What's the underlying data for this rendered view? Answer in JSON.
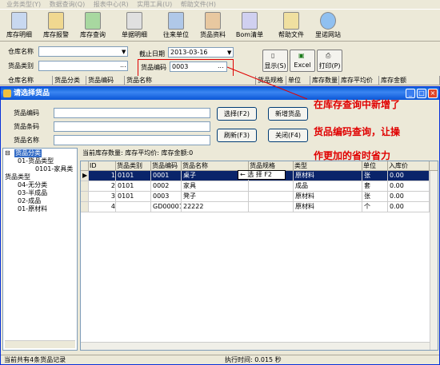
{
  "menu": [
    "业务类型(Y)",
    "数据查询(Q)",
    "报表中心(R)",
    "实用工具(U)",
    "帮助文件(H)"
  ],
  "toolbar": [
    "库存明细",
    "库存报警",
    "库存查询",
    "单据明细",
    "往来单位",
    "货品资料",
    "Bom清单",
    "帮助文件",
    "里诺网站"
  ],
  "filters": {
    "warehouse_label": "仓库名称",
    "category_label": "货品类别",
    "date_label": "截止日期",
    "date_value": "2013-03-16",
    "code_label": "货品编码",
    "code_value": "0003",
    "ellipsis": "...",
    "show_btn": "显示(S)",
    "excel_btn": "Excel",
    "print_btn": "打印(P)"
  },
  "main_columns": [
    "仓库名称",
    "货品分类",
    "货品编码",
    "货品名称",
    "货品规格",
    "单位",
    "库存数量",
    "库存平均价",
    "库存金额"
  ],
  "dialog": {
    "title": "请选择货品",
    "code_label": "货品编码",
    "barcode_label": "货品条码",
    "name_label": "货品名称",
    "select_btn": "选择(F2)",
    "add_btn": "新增货品",
    "refresh_btn": "刷新(F3)",
    "close_btn": "关闭(F4)",
    "summary": "当前库存数量:  库存平均价:  库存金额:0",
    "status_left": "当前共有4条货品记录",
    "status_right": "执行时间: 0.015 秒",
    "tooltip": "← 选 择 F2"
  },
  "tree": {
    "root": "货品分类",
    "n1": "01-货品类型",
    "n1a": "0101-家具类",
    "n2": "货品类型",
    "n2a": "04-无分类",
    "n2b": "03-半成品",
    "n2c": "02-成品",
    "n2d": "01-原材料"
  },
  "table": {
    "columns": [
      "ID",
      "货品类别",
      "货品编码",
      "货品名称",
      "货品规格",
      "类型",
      "单位",
      "入库价"
    ],
    "rows": [
      [
        "1",
        "0101",
        "0001",
        "桌子",
        "",
        "原材料",
        "张",
        "0.00"
      ],
      [
        "2",
        "0101",
        "0002",
        "家具",
        "",
        "成品",
        "套",
        "0.00"
      ],
      [
        "3",
        "0101",
        "0003",
        "凳子",
        "",
        "原材料",
        "张",
        "0.00"
      ],
      [
        "4",
        "",
        "GD00001",
        "22222",
        "",
        "原材料",
        "个",
        "0.00"
      ]
    ]
  },
  "annotations": [
    "在库存查询中新增了",
    "货品编码查询，让操",
    "作更加的省时省力"
  ],
  "colors": {
    "accent": "#0a5fd8",
    "annotation": "#e00000",
    "selected_row": "#0a246a"
  }
}
